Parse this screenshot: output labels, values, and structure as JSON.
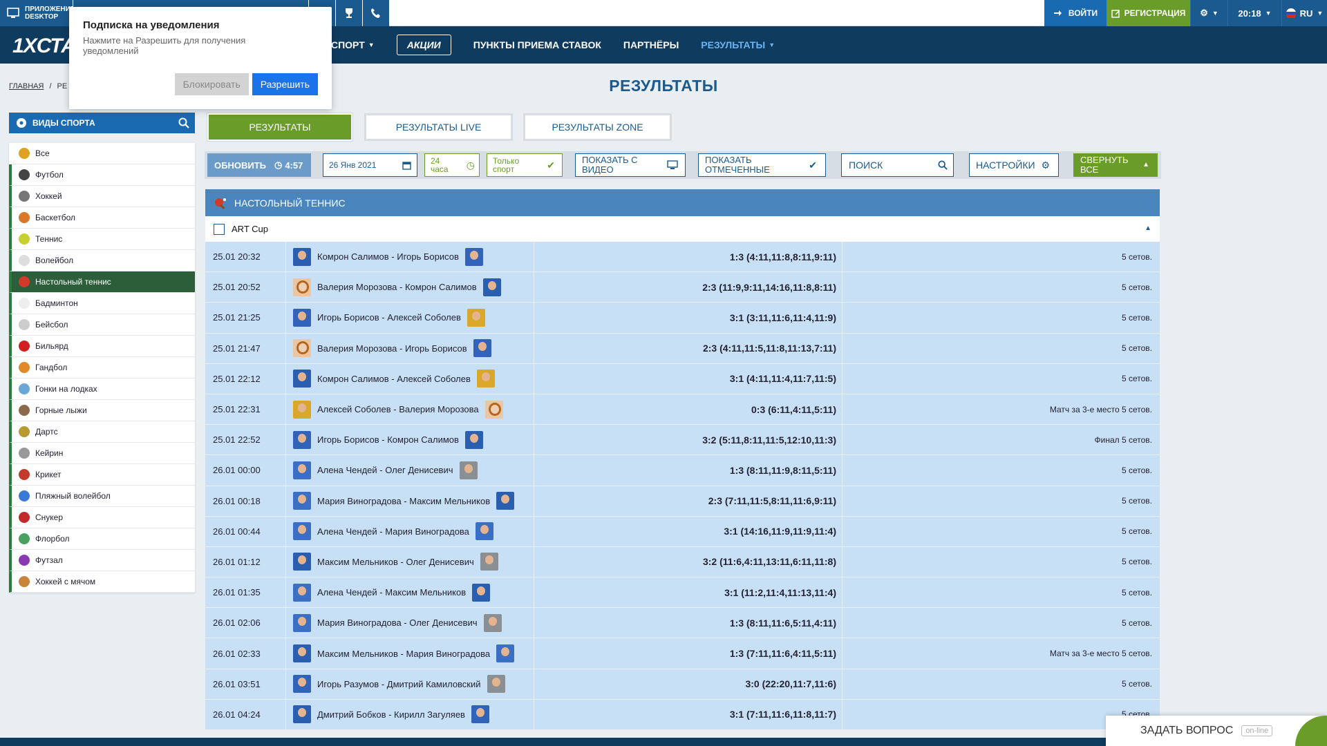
{
  "topbar": {
    "app_label_1": "ПРИЛОЖЕНИЕ",
    "app_label_2": "DESKTOP",
    "login": "ВОЙТИ",
    "register": "РЕГИСТРАЦИЯ",
    "time": "20:18",
    "lang": "RU"
  },
  "nav": {
    "logo": "1XСТА",
    "items": [
      "РСПОРТ",
      "АКЦИИ",
      "ПУНКТЫ ПРИЕМА СТАВОК",
      "ПАРТНЁРЫ",
      "РЕЗУЛЬТАТЫ"
    ]
  },
  "popup": {
    "title": "Подписка на уведомления",
    "text": "Нажмите на Разрешить для получения уведомлений",
    "block": "Блокировать",
    "allow": "Разрешить"
  },
  "breadcrumb": {
    "home": "ГЛАВНАЯ",
    "sep": "/",
    "current": "РЕ"
  },
  "page_title": "РЕЗУЛЬТАТЫ",
  "sidebar": {
    "title": "ВИДЫ СПОРТА",
    "items": [
      {
        "label": "Все",
        "color": "#e0a020"
      },
      {
        "label": "Футбол",
        "color": "#444444"
      },
      {
        "label": "Хоккей",
        "color": "#777777"
      },
      {
        "label": "Баскетбол",
        "color": "#d9772a"
      },
      {
        "label": "Теннис",
        "color": "#c8d030"
      },
      {
        "label": "Волейбол",
        "color": "#dddddd"
      },
      {
        "label": "Настольный теннис",
        "color": "#d23a2a"
      },
      {
        "label": "Бадминтон",
        "color": "#eeeeee"
      },
      {
        "label": "Бейсбол",
        "color": "#cccccc"
      },
      {
        "label": "Бильярд",
        "color": "#d02020"
      },
      {
        "label": "Гандбол",
        "color": "#e08a2a"
      },
      {
        "label": "Гонки на лодках",
        "color": "#6aa6d6"
      },
      {
        "label": "Горные лыжи",
        "color": "#8a6a4a"
      },
      {
        "label": "Дартс",
        "color": "#b89a30"
      },
      {
        "label": "Кейрин",
        "color": "#999999"
      },
      {
        "label": "Крикет",
        "color": "#c23a2a"
      },
      {
        "label": "Пляжный волейбол",
        "color": "#3a7ad6"
      },
      {
        "label": "Снукер",
        "color": "#c02a2a"
      },
      {
        "label": "Флорбол",
        "color": "#4aa060"
      },
      {
        "label": "Футзал",
        "color": "#8a3ab0"
      },
      {
        "label": "Хоккей с мячом",
        "color": "#c8843a"
      }
    ]
  },
  "tabs": [
    "РЕЗУЛЬТАТЫ",
    "РЕЗУЛЬТАТЫ LIVE",
    "РЕЗУЛЬТАТЫ ZONE"
  ],
  "controls": {
    "refresh": "ОБНОВИТЬ",
    "timer": "4:57",
    "date": "26 Янв 2021",
    "hours_1": "24",
    "hours_2": "часа",
    "only_1": "Только",
    "only_2": "спорт",
    "video_1": "ПОКАЗАТЬ С",
    "video_2": "ВИДЕО",
    "marked_1": "ПОКАЗАТЬ",
    "marked_2": "ОТМЕЧЕННЫЕ",
    "search_placeholder": "ПОИСК",
    "settings": "НАСТРОЙКИ",
    "collapse_1": "СВЕРНУТЬ",
    "collapse_2": "ВСЕ"
  },
  "results": {
    "sport": "НАСТОЛЬНЫЙ ТЕННИС",
    "tournament": "ART Cup",
    "rows": [
      {
        "time": "25.01 20:32",
        "match": "Комрон Салимов - Игорь Борисов",
        "score": "1:3 (4:11,11:8,8:11,9:11)",
        "info": "5 сетов.",
        "a1": "av-blue",
        "a2": "av-red"
      },
      {
        "time": "25.01 20:52",
        "match": "Валерия Морозова - Комрон Салимов",
        "score": "2:3 (11:9,9:11,14:16,11:8,8:11)",
        "info": "5 сетов.",
        "a1": "av-f",
        "a2": "av-blue"
      },
      {
        "time": "25.01 21:25",
        "match": "Игорь Борисов - Алексей Соболев",
        "score": "3:1 (3:11,11:6,11:4,11:9)",
        "info": "5 сетов.",
        "a1": "av-red",
        "a2": "av-yellow"
      },
      {
        "time": "25.01 21:47",
        "match": "Валерия Морозова - Игорь Борисов",
        "score": "2:3 (4:11,11:5,11:8,11:13,7:11)",
        "info": "5 сетов.",
        "a1": "av-f",
        "a2": "av-red"
      },
      {
        "time": "25.01 22:12",
        "match": "Комрон Салимов - Алексей Соболев",
        "score": "3:1 (4:11,11:4,11:7,11:5)",
        "info": "5 сетов.",
        "a1": "av-blue",
        "a2": "av-yellow"
      },
      {
        "time": "25.01 22:31",
        "match": "Алексей Соболев - Валерия Морозова",
        "score": "0:3 (6:11,4:11,5:11)",
        "info": "Матч за 3-е место 5 сетов.",
        "a1": "av-yellow",
        "a2": "av-f"
      },
      {
        "time": "25.01 22:52",
        "match": "Игорь Борисов - Комрон Салимов",
        "score": "3:2 (5:11,8:11,11:5,12:10,11:3)",
        "info": "Финал 5 сетов.",
        "a1": "av-red",
        "a2": "av-blue"
      },
      {
        "time": "26.01 00:00",
        "match": "Алена Чендей - Олег Денисевич",
        "score": "1:3 (8:11,11:9,8:11,5:11)",
        "info": "5 сетов.",
        "a1": "av-blue2",
        "a2": "av-grey"
      },
      {
        "time": "26.01 00:18",
        "match": "Мария Виноградова - Максим Мельников",
        "score": "2:3 (7:11,11:5,8:11,11:6,9:11)",
        "info": "5 сетов.",
        "a1": "av-blue2",
        "a2": "av-blue"
      },
      {
        "time": "26.01 00:44",
        "match": "Алена Чендей - Мария Виноградова",
        "score": "3:1 (14:16,11:9,11:9,11:4)",
        "info": "5 сетов.",
        "a1": "av-blue2",
        "a2": "av-blue2"
      },
      {
        "time": "26.01 01:12",
        "match": "Максим Мельников - Олег Денисевич",
        "score": "3:2 (11:6,4:11,13:11,6:11,11:8)",
        "info": "5 сетов.",
        "a1": "av-blue",
        "a2": "av-grey"
      },
      {
        "time": "26.01 01:35",
        "match": "Алена Чендей - Максим Мельников",
        "score": "3:1 (11:2,11:4,11:13,11:4)",
        "info": "5 сетов.",
        "a1": "av-blue2",
        "a2": "av-blue"
      },
      {
        "time": "26.01 02:06",
        "match": "Мария Виноградова - Олег Денисевич",
        "score": "1:3 (8:11,11:6,5:11,4:11)",
        "info": "5 сетов.",
        "a1": "av-blue2",
        "a2": "av-grey"
      },
      {
        "time": "26.01 02:33",
        "match": "Максим Мельников - Мария Виноградова",
        "score": "1:3 (7:11,11:6,4:11,5:11)",
        "info": "Матч за 3-е место 5 сетов.",
        "a1": "av-blue",
        "a2": "av-blue2"
      },
      {
        "time": "26.01 03:51",
        "match": "Игорь Разумов - Дмитрий Камиловский",
        "score": "3:0 (22:20,11:7,11:6)",
        "info": "5 сетов.",
        "a1": "av-red",
        "a2": "av-grey"
      },
      {
        "time": "26.01 04:24",
        "match": "Дмитрий Бобков - Кирилл Загуляев",
        "score": "3:1 (7:11,11:6,11:8,11:7)",
        "info": "5 сетов.",
        "a1": "av-blue",
        "a2": "av-red"
      }
    ]
  },
  "ask": {
    "label": "ЗАДАТЬ ВОПРОС",
    "status": "on-line"
  }
}
